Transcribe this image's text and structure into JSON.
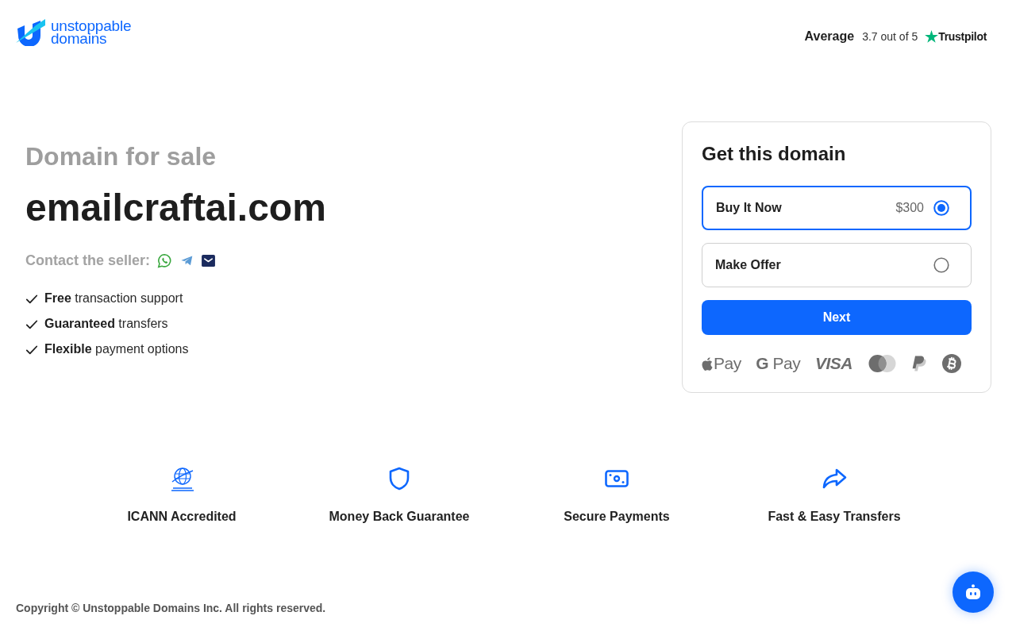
{
  "header": {
    "logo": {
      "lines": [
        "unstoppable",
        "domains"
      ]
    },
    "rating": {
      "label": "Average",
      "score": "3.7 out of 5",
      "brand": "Trustpilot"
    }
  },
  "listing": {
    "eyebrow": "Domain for sale",
    "domain": "emailcraftai.com",
    "contact": {
      "label": "Contact the seller:",
      "channels": [
        {
          "kind": "whatsapp"
        },
        {
          "kind": "telegram"
        },
        {
          "kind": "email"
        }
      ]
    },
    "perks": [
      "**Free** transaction support",
      "**Guaranteed** transfers",
      "**Flexible** payment options"
    ]
  },
  "purchase_card": {
    "title": "Get this domain",
    "options": [
      {
        "label": "Buy It Now",
        "price": "$300",
        "selected": true
      },
      {
        "label": "Make Offer",
        "selected": false
      }
    ],
    "next_button": "Next",
    "payment_methods": [
      {
        "kind": "apple_pay",
        "label": "Pay"
      },
      {
        "kind": "google_pay",
        "label": "**G** Pay"
      },
      {
        "kind": "visa",
        "label": "VISA"
      },
      {
        "kind": "mastercard"
      },
      {
        "kind": "paypal"
      },
      {
        "kind": "bitcoin"
      }
    ]
  },
  "guarantees": [
    {
      "kind": "icann",
      "label": "ICANN Accredited"
    },
    {
      "kind": "shield",
      "label": "Money Back Guarantee"
    },
    {
      "kind": "payment",
      "label": "Secure Payments"
    },
    {
      "kind": "transfer",
      "label": "Fast & Easy Transfers"
    }
  ],
  "footer": {
    "copyright": "Copyright © Unstoppable Domains Inc. All rights reserved."
  }
}
